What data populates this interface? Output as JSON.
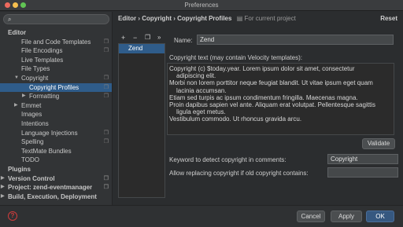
{
  "window": {
    "title": "Preferences"
  },
  "search": {
    "placeholder": "",
    "icon": "search-icon"
  },
  "sidebar": {
    "items": [
      {
        "label": "Editor",
        "bold": true,
        "indent": 0,
        "arrow": "",
        "copy": false,
        "selected": false
      },
      {
        "label": "File and Code Templates",
        "bold": false,
        "indent": 1,
        "arrow": "",
        "copy": true,
        "selected": false
      },
      {
        "label": "File Encodings",
        "bold": false,
        "indent": 1,
        "arrow": "",
        "copy": true,
        "selected": false
      },
      {
        "label": "Live Templates",
        "bold": false,
        "indent": 1,
        "arrow": "",
        "copy": false,
        "selected": false
      },
      {
        "label": "File Types",
        "bold": false,
        "indent": 1,
        "arrow": "",
        "copy": false,
        "selected": false
      },
      {
        "label": "Copyright",
        "bold": false,
        "indent": 1,
        "arrow": "down",
        "copy": true,
        "selected": false
      },
      {
        "label": "Copyright Profiles",
        "bold": false,
        "indent": 2,
        "arrow": "",
        "copy": true,
        "selected": true
      },
      {
        "label": "Formatting",
        "bold": false,
        "indent": 2,
        "arrow": "right",
        "copy": true,
        "selected": false
      },
      {
        "label": "Emmet",
        "bold": false,
        "indent": 1,
        "arrow": "right",
        "copy": false,
        "selected": false
      },
      {
        "label": "Images",
        "bold": false,
        "indent": 1,
        "arrow": "",
        "copy": false,
        "selected": false
      },
      {
        "label": "Intentions",
        "bold": false,
        "indent": 1,
        "arrow": "",
        "copy": false,
        "selected": false
      },
      {
        "label": "Language Injections",
        "bold": false,
        "indent": 1,
        "arrow": "",
        "copy": true,
        "selected": false
      },
      {
        "label": "Spelling",
        "bold": false,
        "indent": 1,
        "arrow": "",
        "copy": true,
        "selected": false
      },
      {
        "label": "TextMate Bundles",
        "bold": false,
        "indent": 1,
        "arrow": "",
        "copy": false,
        "selected": false
      },
      {
        "label": "TODO",
        "bold": false,
        "indent": 1,
        "arrow": "",
        "copy": false,
        "selected": false
      },
      {
        "label": "Plugins",
        "bold": true,
        "indent": 0,
        "arrow": "",
        "copy": false,
        "selected": false
      },
      {
        "label": "Version Control",
        "bold": true,
        "indent": 0,
        "arrow": "right",
        "copy": true,
        "selected": false
      },
      {
        "label": "Project: zend-eventmanager",
        "bold": true,
        "indent": 0,
        "arrow": "right",
        "copy": true,
        "selected": false
      },
      {
        "label": "Build, Execution, Deployment",
        "bold": true,
        "indent": 0,
        "arrow": "right",
        "copy": false,
        "selected": false
      }
    ]
  },
  "header": {
    "breadcrumb": "Editor › Copyright › Copyright Profiles",
    "project_scope": "For current project",
    "reset_label": "Reset"
  },
  "profiles": {
    "add_label": "+",
    "remove_label": "−",
    "copy_icon": "copy-icon",
    "more_label": "»",
    "items": [
      "Zend"
    ]
  },
  "form": {
    "name_label": "Name:",
    "name_value": "Zend",
    "copyright_label": "Copyright text (may contain Velocity templates):",
    "copyright_lines": [
      {
        "text": "Copyright (c) $today.year. Lorem ipsum dolor sit amet, consectetur",
        "indent": false
      },
      {
        "text": "adipiscing elit.",
        "indent": true
      },
      {
        "text": "Morbi non lorem porttitor neque feugiat blandit. Ut vitae ipsum eget quam",
        "indent": false
      },
      {
        "text": "lacinia accumsan.",
        "indent": true
      },
      {
        "text": "Etiam sed turpis ac ipsum condimentum fringilla. Maecenas magna.",
        "indent": false
      },
      {
        "text": "Proin dapibus sapien vel ante. Aliquam erat volutpat. Pellentesque sagittis",
        "indent": false
      },
      {
        "text": "ligula eget metus.",
        "indent": true
      },
      {
        "text": "Vestibulum commodo. Ut rhoncus gravida arcu.",
        "indent": false
      }
    ],
    "validate_label": "Validate",
    "keyword_label": "Keyword to detect copyright in comments:",
    "keyword_value": "Copyright",
    "allow_label": "Allow replacing copyright if old copyright contains:",
    "allow_value": ""
  },
  "footer": {
    "help_label": "?",
    "cancel_label": "Cancel",
    "apply_label": "Apply",
    "ok_label": "OK"
  },
  "colors": {
    "selection": "#2f5c8a",
    "ok_button": "#365880",
    "help": "#cf3c3c"
  }
}
